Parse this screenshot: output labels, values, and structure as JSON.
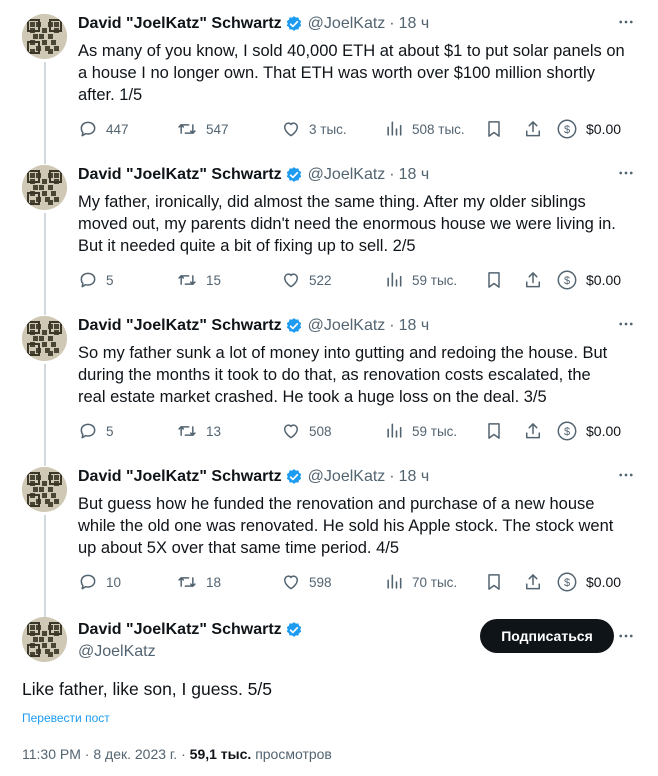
{
  "colors": {
    "accent": "#1d9bf0",
    "text": "#0f1419",
    "muted": "#536471",
    "line": "#cfd9de"
  },
  "author": {
    "name": "David \"JoelKatz\" Schwartz",
    "handle": "@JoelKatz",
    "dot": "·",
    "time": "18 ч"
  },
  "icons": [
    "verified-badge-icon",
    "more-icon",
    "reply-icon",
    "retweet-icon",
    "like-icon",
    "views-icon",
    "bookmark-icon",
    "share-icon",
    "tip-dollar-icon"
  ],
  "tweets": [
    {
      "text": "As many of you know, I sold 40,000 ETH at about $1 to put solar panels on\na house I no longer own. That ETH was worth over $100 million shortly\nafter. 1/5",
      "replies": "447",
      "retweets": "547",
      "likes": "3 тыс.",
      "views": "508 тыс.",
      "tip": "$0.00"
    },
    {
      "text": "My father, ironically, did almost the same thing. After my older siblings\nmoved out, my parents didn't need the enormous house we were living in.\nBut it needed quite a bit of fixing up to sell. 2/5",
      "replies": "5",
      "retweets": "15",
      "likes": "522",
      "views": "59 тыс.",
      "tip": "$0.00"
    },
    {
      "text": "So my father sunk a lot of money into gutting and redoing the house. But\nduring the months it took to do that, as renovation costs escalated, the\nreal estate market crashed. He took a huge loss on the deal. 3/5",
      "replies": "5",
      "retweets": "13",
      "likes": "508",
      "views": "59 тыс.",
      "tip": "$0.00"
    },
    {
      "text": "But guess how he funded the renovation and purchase of a new house\nwhile the old one was renovated. He sold his Apple stock. The stock went\nup about 5X over that same time period. 4/5",
      "replies": "10",
      "retweets": "18",
      "likes": "598",
      "views": "70 тыс.",
      "tip": "$0.00"
    }
  ],
  "main_tweet": {
    "follow_label": "Подписаться",
    "text": "Like father, like son, I guess. 5/5",
    "translate": "Перевести пост",
    "time": "11:30 PM",
    "dot": "·",
    "date": "8 дек. 2023 г.",
    "views_count": "59,1 тыс.",
    "views_label": "просмотров"
  }
}
